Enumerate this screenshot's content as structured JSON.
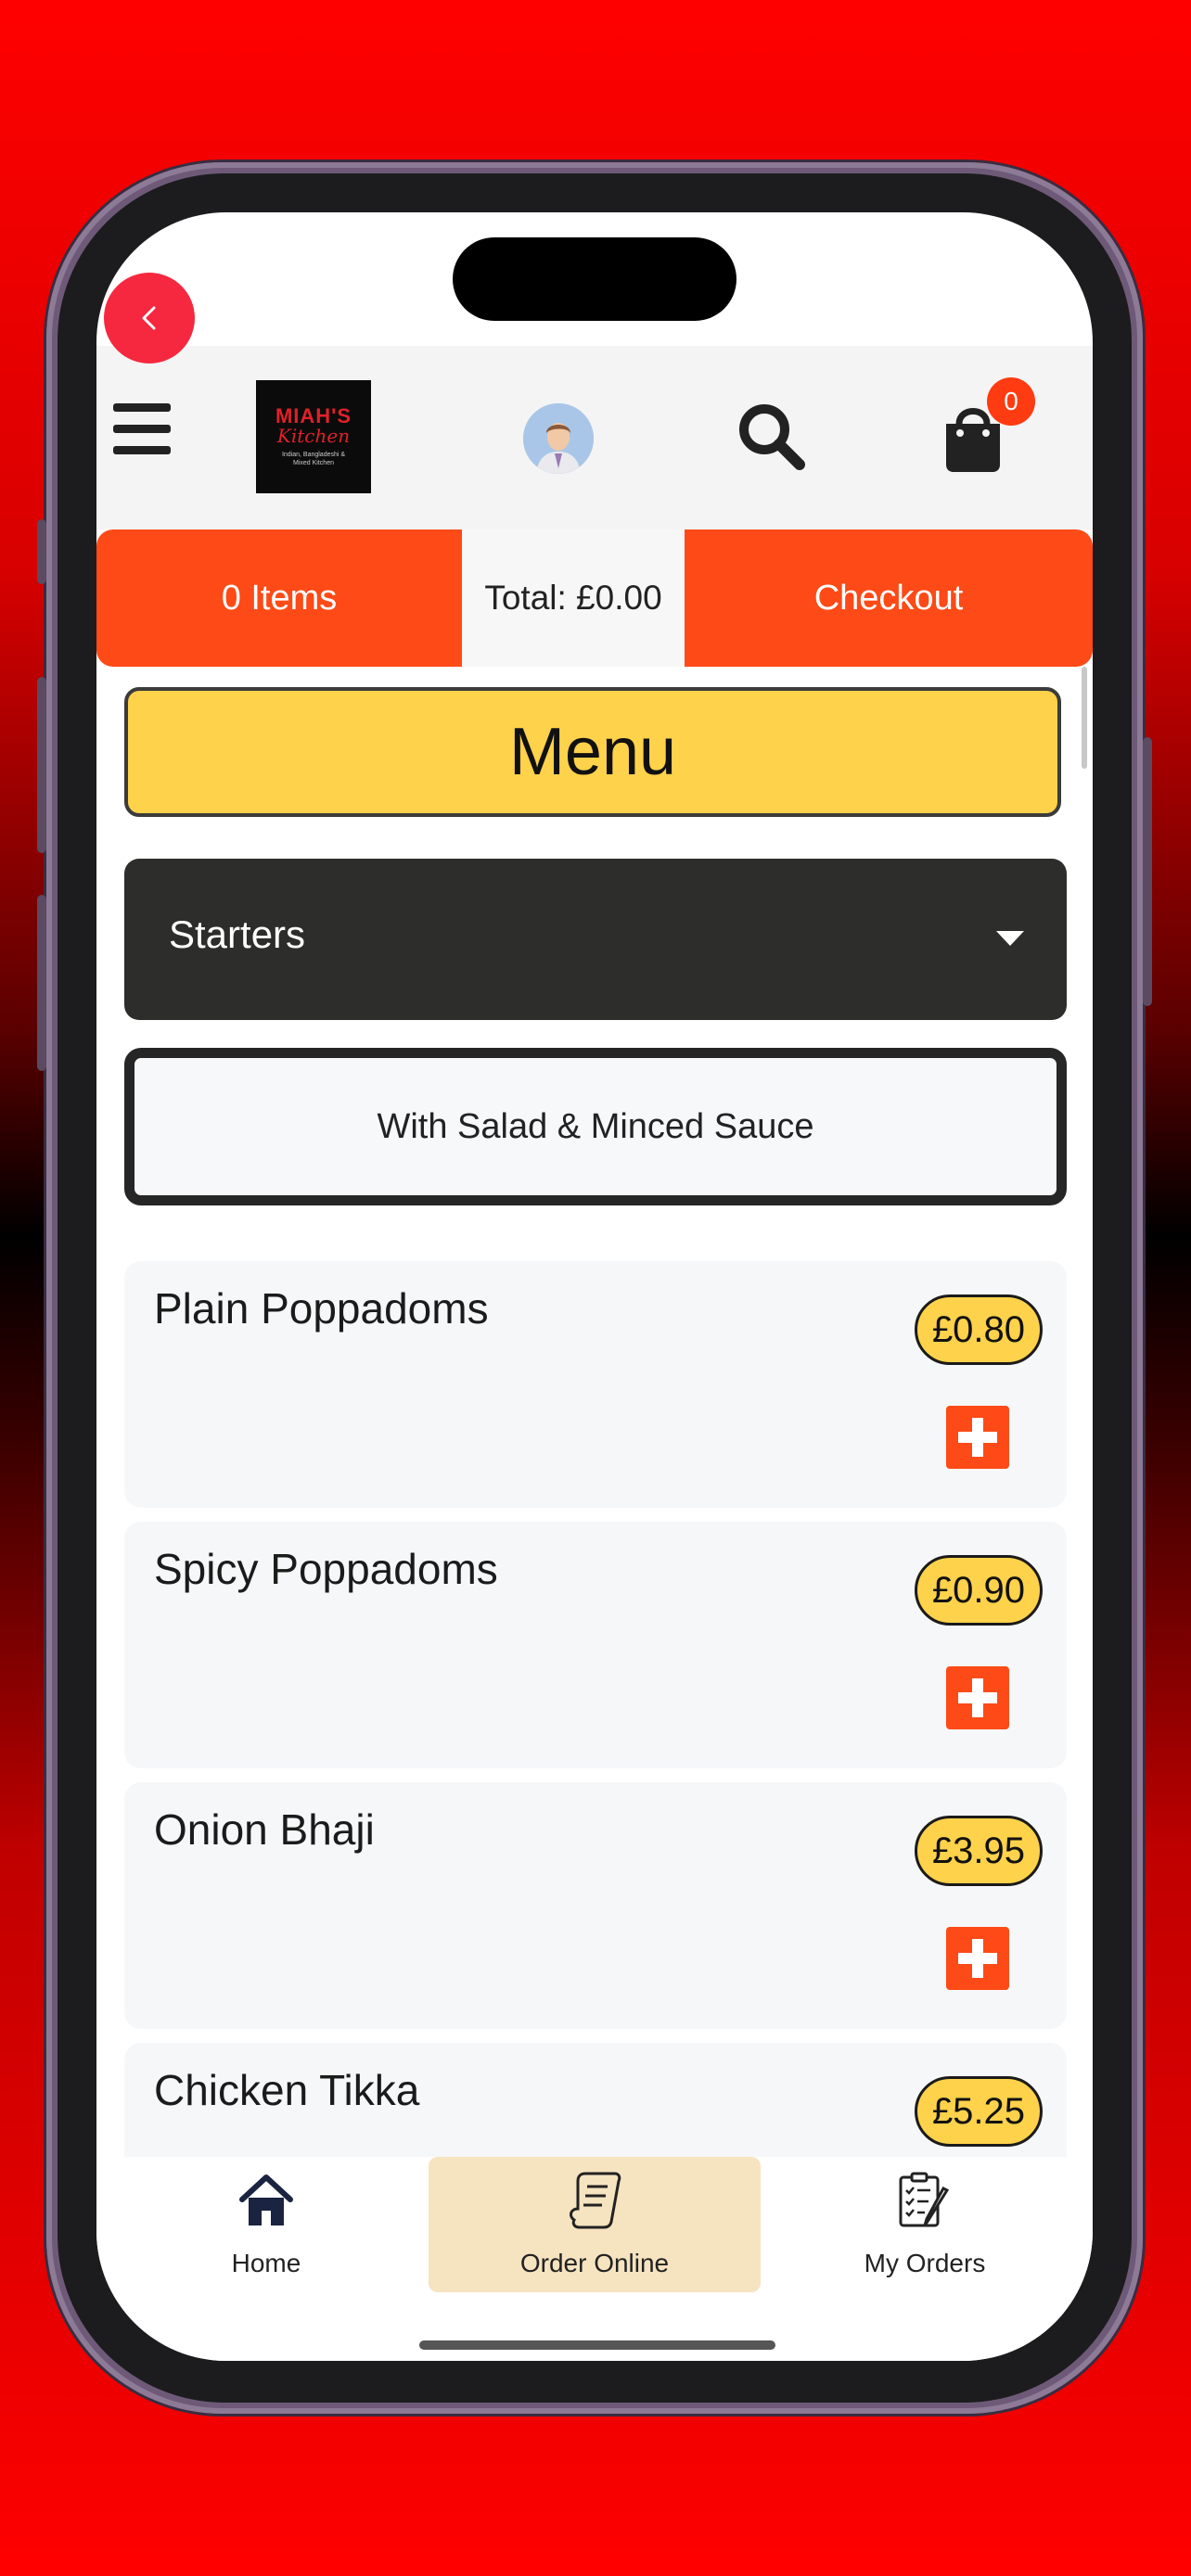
{
  "header": {
    "logo": {
      "line1": "MIAH'S",
      "line2": "Kitchen",
      "line3": "Indian, Bangladeshi & Mixed Kitchen"
    },
    "cart_count": "0"
  },
  "summary": {
    "items": "0 Items",
    "total": "Total: £0.00",
    "checkout": "Checkout"
  },
  "menu": {
    "title": "Menu",
    "category": "Starters",
    "subtitle": "With Salad & Minced Sauce",
    "items": [
      {
        "name": "Plain Poppadoms",
        "price": "£0.80"
      },
      {
        "name": "Spicy Poppadoms",
        "price": "£0.90"
      },
      {
        "name": "Onion Bhaji",
        "price": "£3.95"
      },
      {
        "name": "Chicken Tikka",
        "price": "£5.25"
      }
    ]
  },
  "tabs": [
    {
      "label": "Home",
      "icon": "home-icon"
    },
    {
      "label": "Order Online",
      "icon": "order-online-icon"
    },
    {
      "label": "My Orders",
      "icon": "my-orders-icon"
    }
  ],
  "colors": {
    "accent": "#fd4a17",
    "price_badge": "#fed24a",
    "category_bg": "#2d2d2b",
    "back_button": "#f5283f",
    "active_tab": "#f6e3c0"
  }
}
